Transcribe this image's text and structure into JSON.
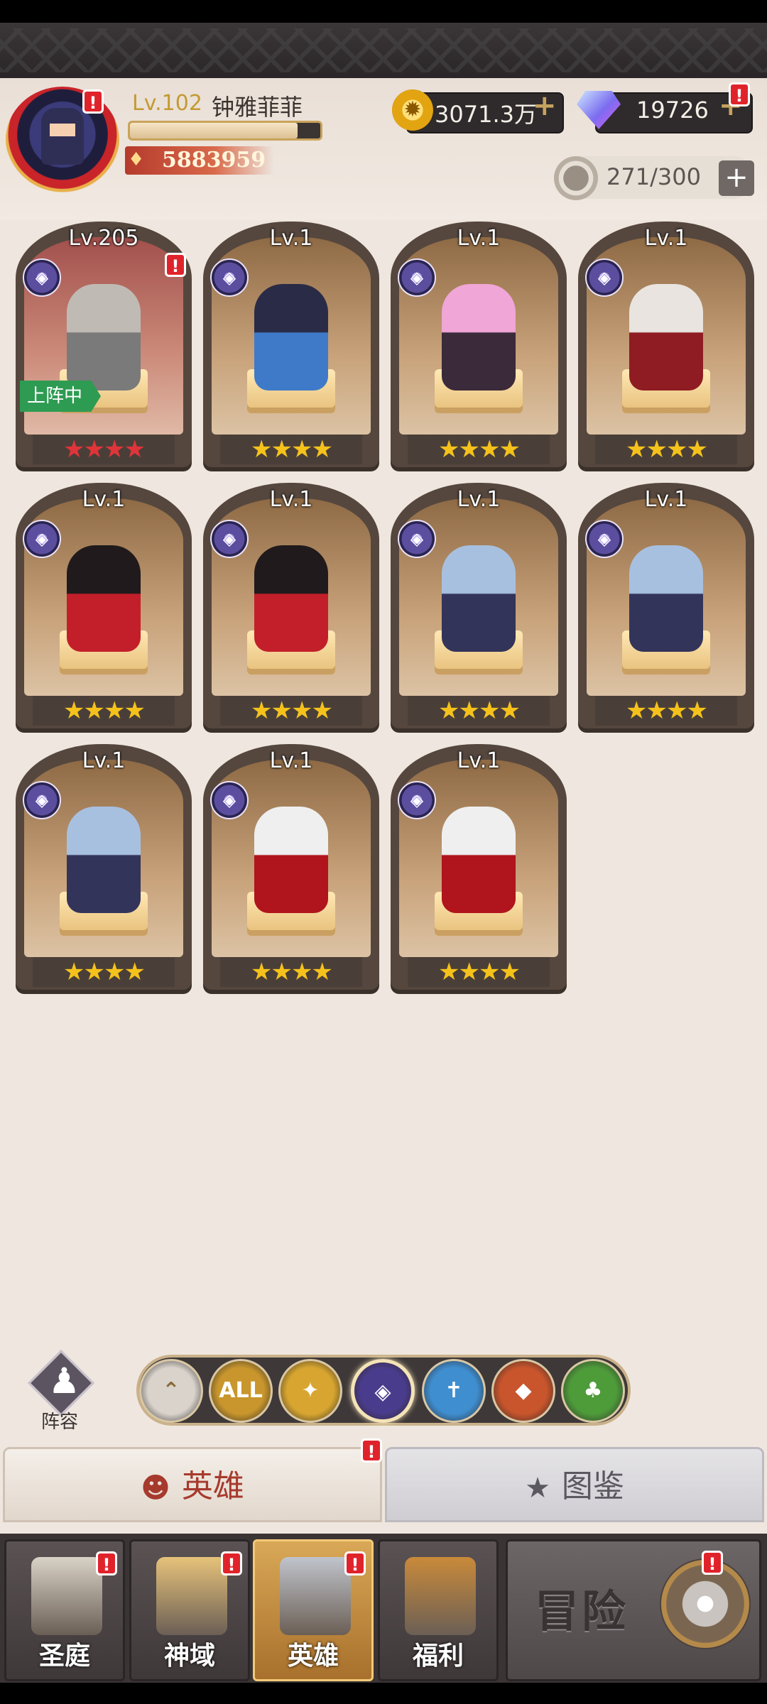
{
  "profile": {
    "level": "Lv.102",
    "name": "钟雅菲菲",
    "exp_fraction": 0.88,
    "power": "5883959"
  },
  "currency": {
    "gold": "3071.3万",
    "gems": "19726",
    "plus_glyph": "+"
  },
  "roster": {
    "count": "271/300",
    "add_glyph": "+"
  },
  "heroes": [
    {
      "level": "Lv.205",
      "stars": "★★★★",
      "star_color": "red",
      "deployed_label": "上阵中",
      "alert": "!",
      "class_icon": "dark-faction-icon",
      "colors": [
        "#bfbab4",
        "#7a7a7a"
      ]
    },
    {
      "level": "Lv.1",
      "stars": "★★★★",
      "class_icon": "dark-faction-icon",
      "colors": [
        "#2a2b46",
        "#3e7ac8"
      ]
    },
    {
      "level": "Lv.1",
      "stars": "★★★★",
      "class_icon": "dark-faction-icon",
      "colors": [
        "#f0a6d6",
        "#3a2a3a"
      ]
    },
    {
      "level": "Lv.1",
      "stars": "★★★★",
      "class_icon": "dark-faction-icon",
      "colors": [
        "#e9e4e0",
        "#8e1c22"
      ]
    },
    {
      "level": "Lv.1",
      "stars": "★★★★",
      "class_icon": "dark-faction-icon",
      "colors": [
        "#201a1c",
        "#c31f2a"
      ]
    },
    {
      "level": "Lv.1",
      "stars": "★★★★",
      "class_icon": "dark-faction-icon",
      "colors": [
        "#201a1c",
        "#c31f2a"
      ]
    },
    {
      "level": "Lv.1",
      "stars": "★★★★",
      "class_icon": "dark-faction-icon",
      "colors": [
        "#a8c0e0",
        "#33345a"
      ]
    },
    {
      "level": "Lv.1",
      "stars": "★★★★",
      "class_icon": "dark-faction-icon",
      "colors": [
        "#a8c0e0",
        "#33345a"
      ]
    },
    {
      "level": "Lv.1",
      "stars": "★★★★",
      "class_icon": "dark-faction-icon",
      "colors": [
        "#a8c0e0",
        "#33345a"
      ]
    },
    {
      "level": "Lv.1",
      "stars": "★★★★",
      "class_icon": "dark-faction-icon",
      "colors": [
        "#efefef",
        "#b0141c"
      ]
    },
    {
      "level": "Lv.1",
      "stars": "★★★★",
      "class_icon": "dark-faction-icon",
      "colors": [
        "#efefef",
        "#b0141c"
      ]
    }
  ],
  "formation": {
    "label": "阵容"
  },
  "filters": [
    {
      "icon": "chevron-up-icon",
      "label": "⌃",
      "color": "#d9d3cc"
    },
    {
      "icon": "all-factions-icon",
      "label": "ALL",
      "color": "#c8962c"
    },
    {
      "icon": "light-faction-icon",
      "label": "✦",
      "color": "#d8a630"
    },
    {
      "icon": "dark-faction-icon",
      "label": "◈",
      "color": "#4a3c8c",
      "selected": true
    },
    {
      "icon": "holy-faction-icon",
      "label": "✝",
      "color": "#3f8ed0"
    },
    {
      "icon": "beast-faction-icon",
      "label": "◆",
      "color": "#c8552c"
    },
    {
      "icon": "nature-faction-icon",
      "label": "♣",
      "color": "#4e9b3a"
    }
  ],
  "tabs": {
    "heroes": "英雄",
    "heroes_icon": "☻",
    "dex": "图鉴",
    "dex_icon": "★",
    "alert": "!"
  },
  "nav": {
    "items": [
      {
        "label": "圣庭",
        "icon": "sanctuary-icon",
        "color": "#d9d2c6",
        "alert": "!"
      },
      {
        "label": "神域",
        "icon": "divine-realm-icon",
        "color": "#e6c27a",
        "alert": "!"
      },
      {
        "label": "英雄",
        "icon": "hero-helmet-icon",
        "color": "#c0c4cc",
        "alert": "!",
        "selected": true
      },
      {
        "label": "福利",
        "icon": "treasure-chest-icon",
        "color": "#c98a3a"
      }
    ],
    "adventure": "冒险",
    "adventure_alert": "!"
  },
  "alerts": {
    "avatar": "!",
    "gems": "!"
  }
}
